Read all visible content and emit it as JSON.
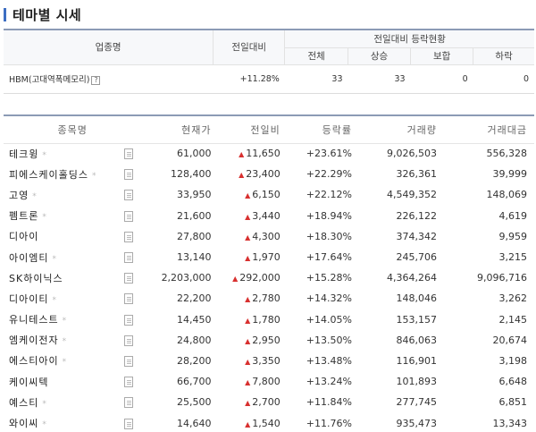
{
  "page": {
    "title": "테마별 시세"
  },
  "summary": {
    "headers": {
      "sector": "업종명",
      "change": "전일대비",
      "group": "전일대비 등락현황",
      "total": "전체",
      "up": "상승",
      "flat": "보합",
      "down": "하락"
    },
    "row": {
      "name": "HBM(고대역폭메모리)",
      "help_icon": "?",
      "change": "+11.28%",
      "total": "33",
      "up": "33",
      "flat": "0",
      "down": "0"
    }
  },
  "stocks": {
    "headers": {
      "name": "종목명",
      "price": "현재가",
      "change": "전일비",
      "rate": "등락률",
      "volume": "거래량",
      "amount": "거래대금"
    },
    "rows": [
      {
        "name": "테크윙",
        "star": "*",
        "price": "61,000",
        "change": "11,650",
        "rate": "+23.61%",
        "volume": "9,026,503",
        "amount": "556,328"
      },
      {
        "name": "피에스케이홀딩스",
        "star": "*",
        "price": "128,400",
        "change": "23,400",
        "rate": "+22.29%",
        "volume": "326,361",
        "amount": "39,999"
      },
      {
        "name": "고영",
        "star": "*",
        "price": "33,950",
        "change": "6,150",
        "rate": "+22.12%",
        "volume": "4,549,352",
        "amount": "148,069"
      },
      {
        "name": "펨트론",
        "star": "*",
        "price": "21,600",
        "change": "3,440",
        "rate": "+18.94%",
        "volume": "226,122",
        "amount": "4,619"
      },
      {
        "name": "디아이",
        "star": "",
        "price": "27,800",
        "change": "4,300",
        "rate": "+18.30%",
        "volume": "374,342",
        "amount": "9,959"
      },
      {
        "name": "아이엠티",
        "star": "*",
        "price": "13,140",
        "change": "1,970",
        "rate": "+17.64%",
        "volume": "245,706",
        "amount": "3,215"
      },
      {
        "name": "SK하이닉스",
        "star": "",
        "price": "2,203,000",
        "change": "292,000",
        "rate": "+15.28%",
        "volume": "4,364,264",
        "amount": "9,096,716"
      },
      {
        "name": "디아이티",
        "star": "*",
        "price": "22,200",
        "change": "2,780",
        "rate": "+14.32%",
        "volume": "148,046",
        "amount": "3,262"
      },
      {
        "name": "유니테스트",
        "star": "*",
        "price": "14,450",
        "change": "1,780",
        "rate": "+14.05%",
        "volume": "153,157",
        "amount": "2,145"
      },
      {
        "name": "엠케이전자",
        "star": "*",
        "price": "24,800",
        "change": "2,950",
        "rate": "+13.50%",
        "volume": "846,063",
        "amount": "20,674"
      },
      {
        "name": "에스티아이",
        "star": "*",
        "price": "28,200",
        "change": "3,350",
        "rate": "+13.48%",
        "volume": "116,901",
        "amount": "3,198"
      },
      {
        "name": "케이씨텍",
        "star": "",
        "price": "66,700",
        "change": "7,800",
        "rate": "+13.24%",
        "volume": "101,893",
        "amount": "6,648"
      },
      {
        "name": "예스티",
        "star": "*",
        "price": "25,500",
        "change": "2,700",
        "rate": "+11.84%",
        "volume": "277,745",
        "amount": "6,851"
      },
      {
        "name": "와이씨",
        "star": "*",
        "price": "14,640",
        "change": "1,540",
        "rate": "+11.76%",
        "volume": "935,473",
        "amount": "13,343"
      }
    ],
    "up_arrow": "▲"
  },
  "colors": {
    "accent": "#3d6ec2",
    "up": "#d8302f",
    "header_border": "#8c9bb5"
  }
}
